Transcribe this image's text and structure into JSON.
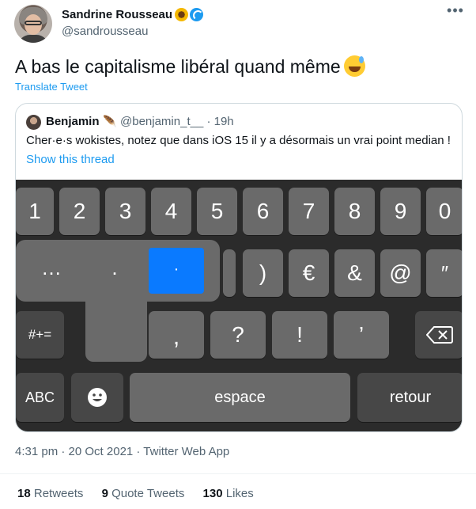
{
  "author": {
    "name": "Sandrine Rousseau",
    "handle": "@sandrousseau",
    "emoji_icons": [
      "sunflower-icon",
      "water-wave-icon"
    ]
  },
  "tweet": {
    "text": "A bas le capitalisme libéral quand même",
    "emoji_icon": "sweat-smile-icon",
    "translate_label": "Translate Tweet"
  },
  "quote": {
    "name": "Benjamin",
    "feather_icon": "feather-icon",
    "handle_time": "@benjamin_t__ · 19h",
    "text": "Cher·e·s wokistes, notez que dans iOS 15 il y a désormais un vrai point median !",
    "thread_link": "Show this thread",
    "keyboard": {
      "number_row": [
        "1",
        "2",
        "3",
        "4",
        "5",
        "6",
        "7",
        "8",
        "9",
        "0"
      ],
      "symbol_row": [
        ")",
        "€",
        "&",
        "@",
        "″"
      ],
      "punct_row": [
        "?",
        "!",
        "’"
      ],
      "popup_options": [
        "…",
        ".",
        "·"
      ],
      "popup_selected": "·",
      "comma": ",",
      "shift_label": "#+=",
      "abc_label": "ABC",
      "space_label": "espace",
      "return_label": "retour",
      "delete_icon": "backspace-icon",
      "emoji_icon": "smiley-icon",
      "accent_color": "#0a7aff"
    }
  },
  "meta": {
    "timestamp": "4:31 pm · 20 Oct 2021 · Twitter Web App"
  },
  "stats": {
    "retweets_count": "18",
    "retweets_label": "Retweets",
    "quotes_count": "9",
    "quotes_label": "Quote Tweets",
    "likes_count": "130",
    "likes_label": "Likes"
  }
}
